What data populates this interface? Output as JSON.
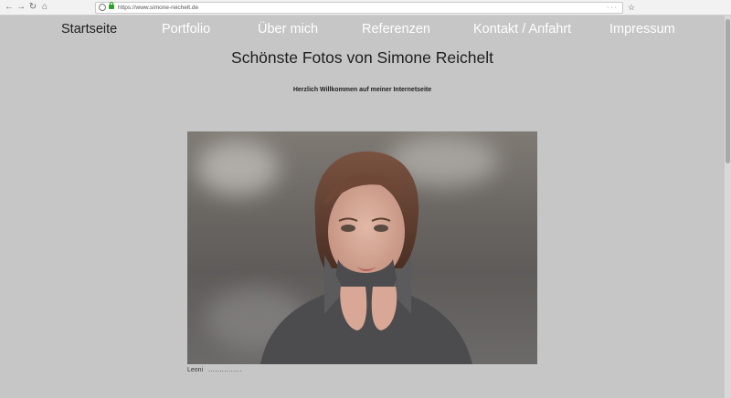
{
  "browser": {
    "url": "https://www.simone-reichelt.de",
    "back_icon": "arrow-left-icon",
    "forward_icon": "arrow-right-icon",
    "reload_icon": "reload-icon",
    "home_icon": "home-icon",
    "page_actions": "···",
    "bookmark_star": "☆"
  },
  "nav": {
    "items": [
      {
        "label": "Startseite",
        "active": true
      },
      {
        "label": "Portfolio",
        "active": false
      },
      {
        "label": "Über mich",
        "active": false
      },
      {
        "label": "Referenzen",
        "active": false
      },
      {
        "label": "Kontakt / Anfahrt",
        "active": false
      },
      {
        "label": "Impressum",
        "active": false
      }
    ]
  },
  "page": {
    "title": "Schönste Fotos von Simone Reichelt",
    "welcome": "Herzlich Willkommen auf meiner Internetseite"
  },
  "photo": {
    "caption_name": "Leoni",
    "caption_dots": "..............."
  },
  "colors": {
    "background": "#c6c6c6",
    "nav_text": "#ffffff",
    "nav_active": "#1e1e1e"
  }
}
